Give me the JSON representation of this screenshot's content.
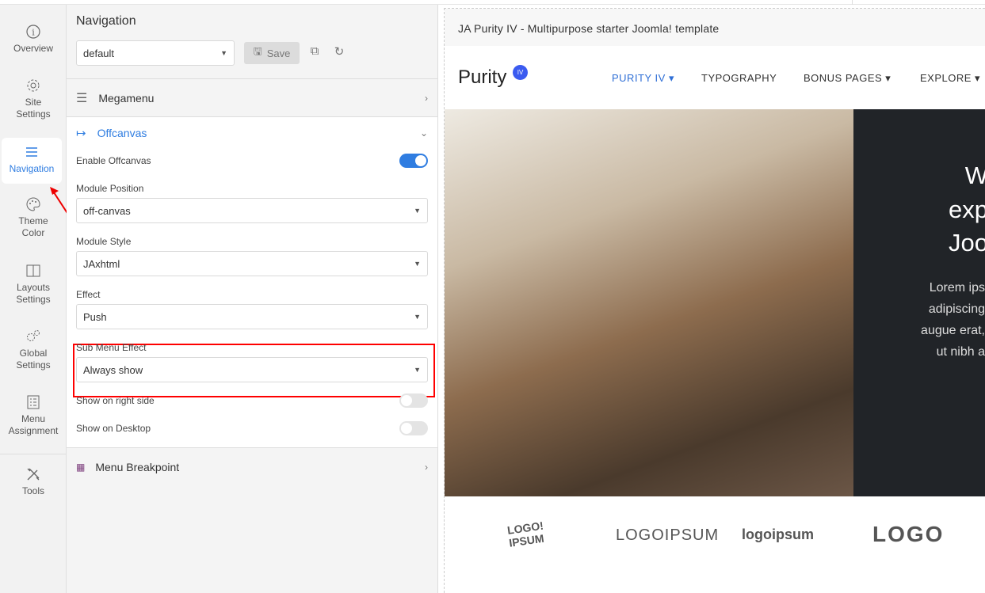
{
  "sidebar": {
    "items": [
      {
        "label1": "Overview",
        "label2": ""
      },
      {
        "label1": "Site",
        "label2": "Settings"
      },
      {
        "label1": "Navigation",
        "label2": ""
      },
      {
        "label1": "Theme",
        "label2": "Color"
      },
      {
        "label1": "Layouts",
        "label2": "Settings"
      },
      {
        "label1": "Global",
        "label2": "Settings"
      },
      {
        "label1": "Menu",
        "label2": "Assignment"
      },
      {
        "label1": "Tools",
        "label2": ""
      }
    ]
  },
  "panel": {
    "title": "Navigation",
    "profile": "default",
    "save": "Save",
    "sections": {
      "megamenu": "Megamenu",
      "offcanvas": "Offcanvas",
      "breakpoint": "Menu Breakpoint"
    },
    "fields": {
      "enable_offcanvas": {
        "label": "Enable Offcanvas",
        "on": true
      },
      "module_position": {
        "label": "Module Position",
        "value": "off-canvas"
      },
      "module_style": {
        "label": "Module Style",
        "value": "JAxhtml"
      },
      "effect": {
        "label": "Effect",
        "value": "Push"
      },
      "sub_menu_effect": {
        "label": "Sub Menu Effect",
        "value": "Always show"
      },
      "show_right": {
        "label": "Show on right side",
        "on": false
      },
      "show_desktop": {
        "label": "Show on Desktop",
        "on": false
      }
    }
  },
  "preview": {
    "title": "JA Purity IV - Multipurpose starter Joomla! template",
    "logo": "Purity",
    "logo_badge": "IV",
    "nav": [
      "PURITY IV",
      "TYPOGRAPHY",
      "BONUS PAGES",
      "EXPLORE"
    ],
    "hero_heading": [
      "W",
      "exp",
      "Joo"
    ],
    "hero_text": [
      "Lorem ips",
      "adipiscing",
      "augue erat,",
      "ut nibh a"
    ],
    "logos": [
      "LOGO! IPSUM",
      "LOGOIPSUM",
      "logoipsum",
      "LOGO"
    ]
  },
  "colors": {
    "accent": "#2f7de1",
    "highlight": "#ff0000"
  }
}
